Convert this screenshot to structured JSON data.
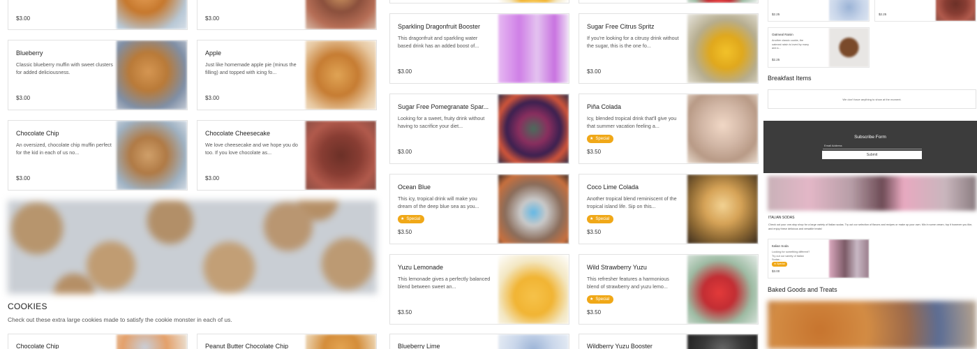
{
  "muffins": [
    {
      "name": "",
      "desc": "",
      "price": "$3.00"
    },
    {
      "name": "",
      "desc": "",
      "price": "$3.00"
    },
    {
      "name": "Blueberry",
      "desc": "Classic blueberry muffin with sweet clusters for added deliciousness.",
      "price": "$3.00"
    },
    {
      "name": "Apple",
      "desc": "Just like homemade apple pie (minus the filling) and topped with icing fo...",
      "price": "$3.00"
    },
    {
      "name": "Chocolate Chip",
      "desc": "An oversized, chocolate chip muffin perfect for the kid in each of us no...",
      "price": "$3.00"
    },
    {
      "name": "Chocolate Cheesecake",
      "desc": "We love cheesecake and we hope you do too. If you love chocolate as...",
      "price": "$3.00"
    }
  ],
  "cookies_section": {
    "title": "COOKIES",
    "desc": "Check out these extra large cookies made to satisfy the cookie monster in each of us."
  },
  "cookies": [
    {
      "name": "Chocolate Chip"
    },
    {
      "name": "Peanut Butter Chocolate Chip"
    }
  ],
  "drinks": [
    {
      "name": "Sparkling Dragonfruit Booster",
      "desc": "This dragonfruit and sparkling water based drink has an added boost of...",
      "price": "$3.00",
      "special": false
    },
    {
      "name": "Sugar Free Citrus Spritz",
      "desc": "If you're looking for a citrusy drink without the sugar, this is the one fo...",
      "price": "$3.00",
      "special": false
    },
    {
      "name": "Sugar Free Pomegranate Spar...",
      "desc": "Looking for a sweet, fruity drink without having to sacrifice your diet...",
      "price": "$3.00",
      "special": false
    },
    {
      "name": "Piña Colada",
      "desc": "Icy, blended tropical drink that'll give you that summer vacation feeling a...",
      "price": "$3.50",
      "special": true
    },
    {
      "name": "Ocean Blue",
      "desc": "This icy, tropical drink will make you dream of the deep blue sea as you...",
      "price": "$3.50",
      "special": true
    },
    {
      "name": "Coco Lime Colada",
      "desc": "Another tropical blend reminiscent of the tropical island life. Sip on this...",
      "price": "$3.50",
      "special": true
    },
    {
      "name": "Yuzu Lemonade",
      "desc": "This lemonade gives a perfectly balanced blend between sweet an...",
      "price": "$3.50",
      "special": false
    },
    {
      "name": "Wild Strawberry Yuzu",
      "desc": "This refresher features a harmonious blend of strawberry and yuzu lemo...",
      "price": "$3.50",
      "special": true
    },
    {
      "name": "Blueberry Lime"
    },
    {
      "name": "Wildberry Yuzu Booster"
    }
  ],
  "special_label": "Special",
  "right": {
    "top_prices": [
      "$2.25",
      "$2.25"
    ],
    "oatmeal": {
      "name": "Oatmeal Raisin",
      "desc": "Another classic cookie, the oatmeal raisin is loved by many and a...",
      "price": "$2.25"
    },
    "breakfast_heading": "Breakfast Items",
    "empty_msg": "We don't have anything to show at the moment.",
    "subscribe": {
      "title": "Subscribe Form",
      "email_label": "Email Address",
      "submit": "Submit"
    },
    "italian_title": "ITALIAN SODAS",
    "italian_desc": "Check out your one-stop shop for a large variety of Italian sodas. Try out our selection of flavors and recipes or make up your own. Mix in some cream, top it however you like, and enjoy these delicious and versatile treats!",
    "italian_card": {
      "name": "Italian Soda",
      "desc": "Looking for something different? Try out our variety of Italian Sodas...",
      "price": "$3.00"
    },
    "baked_heading": "Baked Goods and Treats"
  },
  "colors": {
    "special_badge": "#f0a818",
    "subscribe_bg": "#3c3c3c"
  }
}
